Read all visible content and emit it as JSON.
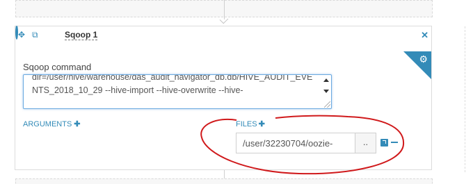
{
  "node": {
    "title": "Sqoop 1",
    "icons": [
      "move-icon",
      "copy-icon",
      "spinner-icon",
      "close-icon",
      "gears-icon"
    ]
  },
  "command": {
    "label": "Sqoop command",
    "value": "dir=/user/hive/warehouse/das_audit_navigator_db.db/HIVE_AUDIT_EVENTS_2018_10_29 --hive-import --hive-overwrite --hive-"
  },
  "arguments": {
    "label": "ARGUMENTS"
  },
  "files": {
    "label": "FILES",
    "value": "/user/32230704/oozie-",
    "browse_label": ".."
  },
  "annotation": {
    "color": "#d0191b"
  }
}
